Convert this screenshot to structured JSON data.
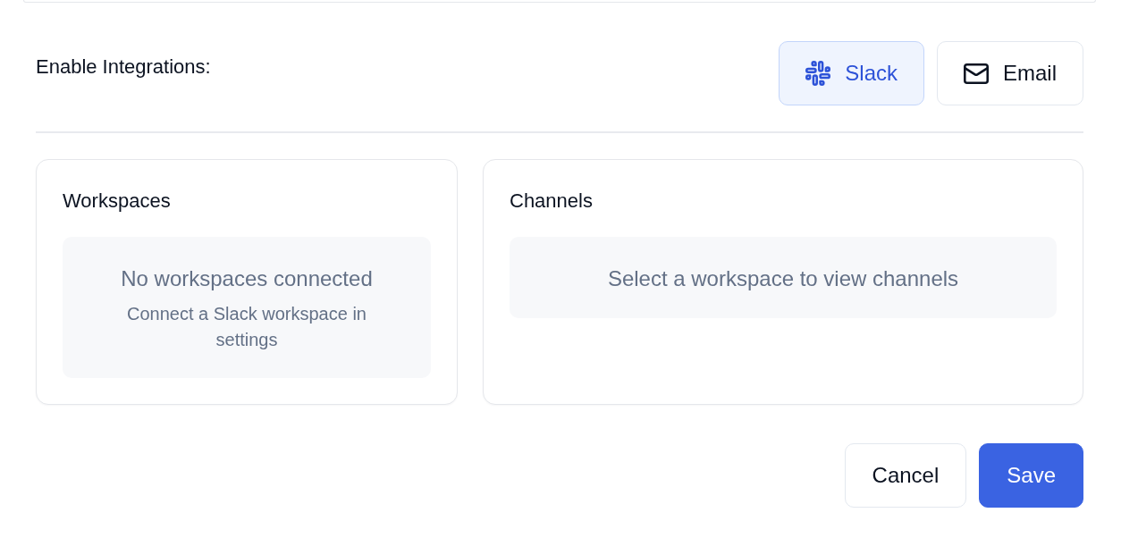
{
  "integrations": {
    "label": "Enable Integrations:",
    "options": [
      {
        "kind": "slack",
        "label": "Slack",
        "selected": true
      },
      {
        "kind": "email",
        "label": "Email",
        "selected": false
      }
    ]
  },
  "panels": [
    {
      "title": "Workspaces",
      "empty_title": "No workspaces connected",
      "empty_hint": "Connect a Slack workspace in settings"
    },
    {
      "title": "Channels",
      "empty_title": "Select a workspace to view channels"
    }
  ],
  "buttons": [
    {
      "kind": "cancel",
      "label": "Cancel"
    },
    {
      "kind": "save",
      "label": "Save"
    }
  ]
}
